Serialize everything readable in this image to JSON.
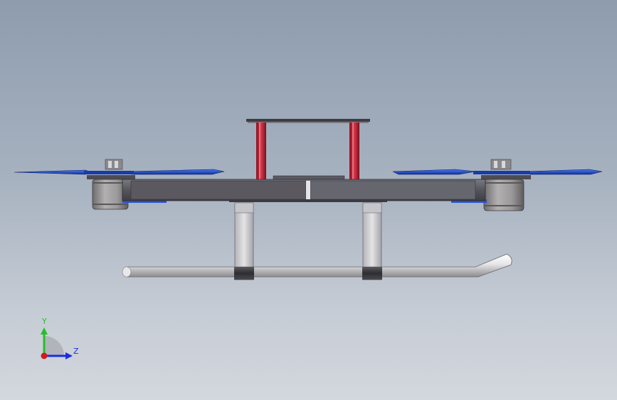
{
  "view": {
    "title": "",
    "background_top": "#8e9cae",
    "background_bottom": "#d3d7de"
  },
  "model": {
    "name": "quadcopter-drone-assembly",
    "view_orientation": "side",
    "components": [
      "top-plate",
      "standoffs",
      "main-frame",
      "motors",
      "propellers",
      "landing-legs",
      "landing-skid"
    ],
    "colors": {
      "standoff": "#c8283a",
      "propeller": "#1e4fd0",
      "frame": "#5a5a62",
      "motor": "#8c8a8a",
      "skid": "#e4e4e6",
      "leg": "#cfcfd2"
    }
  },
  "triad": {
    "y_label": "Y",
    "z_label": "Z",
    "y_color": "#22c02a",
    "z_color": "#1a2ee0",
    "x_color": "#d01c1c"
  }
}
